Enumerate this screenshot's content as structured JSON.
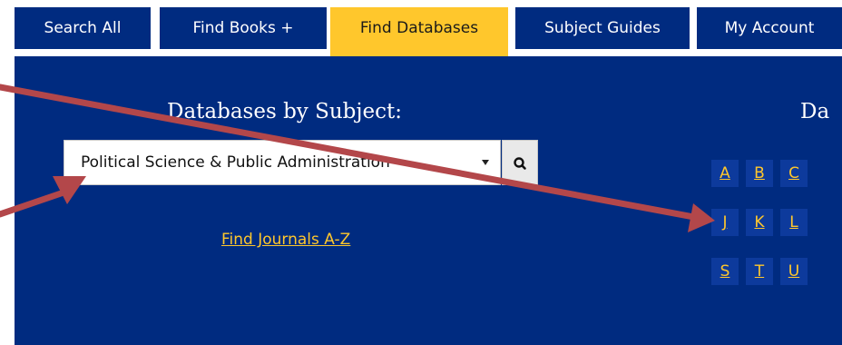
{
  "tabs": [
    {
      "label": "Search All",
      "active": false
    },
    {
      "label": "Find Books +",
      "active": false
    },
    {
      "label": "Find Databases",
      "active": true
    },
    {
      "label": "Subject Guides",
      "active": false
    },
    {
      "label": "My Account",
      "active": false
    }
  ],
  "subject_section": {
    "title": "Databases by Subject:",
    "selected_subject": "Political Science & Public Administration",
    "journals_link": "Find Journals A-Z"
  },
  "az_section": {
    "title_partial": "Da",
    "letters": [
      "A",
      "B",
      "C",
      "J",
      "K",
      "L",
      "S",
      "T",
      "U"
    ]
  },
  "colors": {
    "navy": "#002b80",
    "gold": "#ffc72c",
    "annotation_arrow": "#b3474a"
  }
}
